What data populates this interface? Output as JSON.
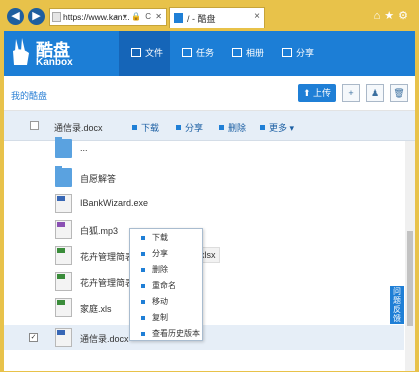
{
  "browser": {
    "url": "https://www.kan...",
    "address_tools": "⌕ ▾ 🔒 C ✕",
    "tab_title": "/ - 酷盘",
    "tab_close": "×",
    "icons": [
      "home-icon",
      "star-icon",
      "gear-icon"
    ]
  },
  "header": {
    "logo_cn": "酷盘",
    "logo_en": "Kanbox",
    "nav": [
      {
        "label": "文件",
        "icon": "folder-icon"
      },
      {
        "label": "任务",
        "icon": "task-icon"
      },
      {
        "label": "相册",
        "icon": "photo-icon"
      },
      {
        "label": "分享",
        "icon": "share-icon"
      }
    ]
  },
  "breadcrumb": "我的酷盘",
  "toolbar": {
    "upload_label": "上传"
  },
  "selection_bar": {
    "filename": "通信录.docx",
    "actions": [
      "下载",
      "分享",
      "删除",
      "更多"
    ]
  },
  "files": [
    {
      "name": "...",
      "type": "folder"
    },
    {
      "name": "自愿解答",
      "type": "folder"
    },
    {
      "name": "IBankWizard.exe",
      "type": "doc"
    },
    {
      "name": "白狐.mp3",
      "type": "mp3"
    },
    {
      "name": "花卉管理简表",
      "type": "xls",
      "tail": "...).xlsx"
    },
    {
      "name": "花卉管理简表",
      "type": "xls"
    },
    {
      "name": "家庭.xls",
      "type": "xls"
    },
    {
      "name": "通信录.docx",
      "type": "doc",
      "selected": true
    }
  ],
  "context_menu": [
    "下载",
    "分享",
    "删除",
    "重命名",
    "移动",
    "复制",
    "查看历史版本"
  ],
  "feedback_label": "问题反馈",
  "colors": {
    "brand": "#1c7ed6",
    "chrome": "#e8c24a"
  }
}
